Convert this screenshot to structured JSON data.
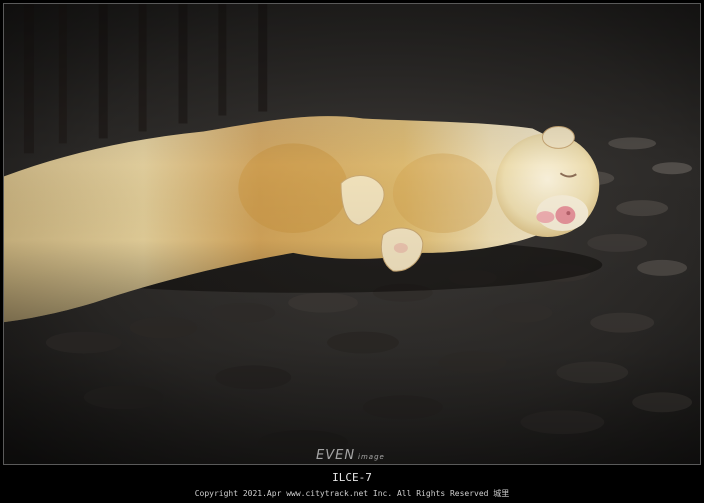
{
  "photo": {
    "subject": "sleeping-ferret",
    "watermark_main": "EVEN",
    "watermark_sub": "image"
  },
  "caption": {
    "camera": "ILCE-7",
    "copyright": "Copyright 2021.Apr www.citytrack.net Inc. All Rights Reserved 城里"
  },
  "colors": {
    "frame": "#000000",
    "ground": "#2a2826",
    "fur_light": "#f2dfa8",
    "fur_gold": "#d9b163",
    "nose": "#e59aa0"
  }
}
